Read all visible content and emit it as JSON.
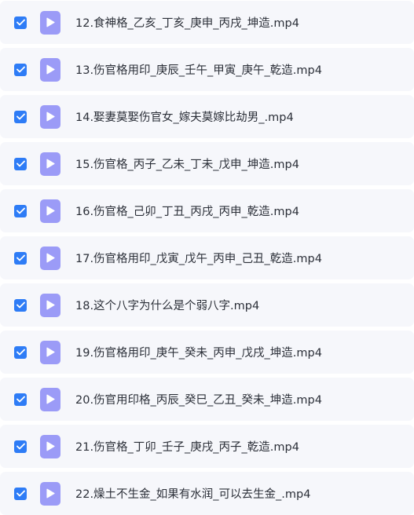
{
  "colors": {
    "checkbox": "#2e7cf6",
    "file_icon": "#9b9bf7",
    "row_background": "#f6f7fb",
    "text": "#2b2f38"
  },
  "files": [
    {
      "name": "12.食神格_乙亥_丁亥_庚申_丙戌_坤造.mp4",
      "checked": true,
      "icon": "video-file-icon"
    },
    {
      "name": "13.伤官格用印_庚辰_壬午_甲寅_庚午_乾造.mp4",
      "checked": true,
      "icon": "video-file-icon"
    },
    {
      "name": "14.娶妻莫娶伤官女_嫁夫莫嫁比劫男_.mp4",
      "checked": true,
      "icon": "video-file-icon"
    },
    {
      "name": "15.伤官格_丙子_乙未_丁未_戊申_坤造.mp4",
      "checked": true,
      "icon": "video-file-icon"
    },
    {
      "name": "16.伤官格_己卯_丁丑_丙戌_丙申_乾造.mp4",
      "checked": true,
      "icon": "video-file-icon"
    },
    {
      "name": "17.伤官格用印_戊寅_戊午_丙申_己丑_乾造.mp4",
      "checked": true,
      "icon": "video-file-icon"
    },
    {
      "name": "18.这个八字为什么是个弱八字.mp4",
      "checked": true,
      "icon": "video-file-icon"
    },
    {
      "name": "19.伤官格用印_庚午_癸未_丙申_戊戌_坤造.mp4",
      "checked": true,
      "icon": "video-file-icon"
    },
    {
      "name": "20.伤官用印格_丙辰_癸巳_乙丑_癸未_坤造.mp4",
      "checked": true,
      "icon": "video-file-icon"
    },
    {
      "name": "21.伤官格_丁卯_壬子_庚戌_丙子_乾造.mp4",
      "checked": true,
      "icon": "video-file-icon"
    },
    {
      "name": "22.燥土不生金_如果有水润_可以去生金_.mp4",
      "checked": true,
      "icon": "video-file-icon"
    }
  ]
}
